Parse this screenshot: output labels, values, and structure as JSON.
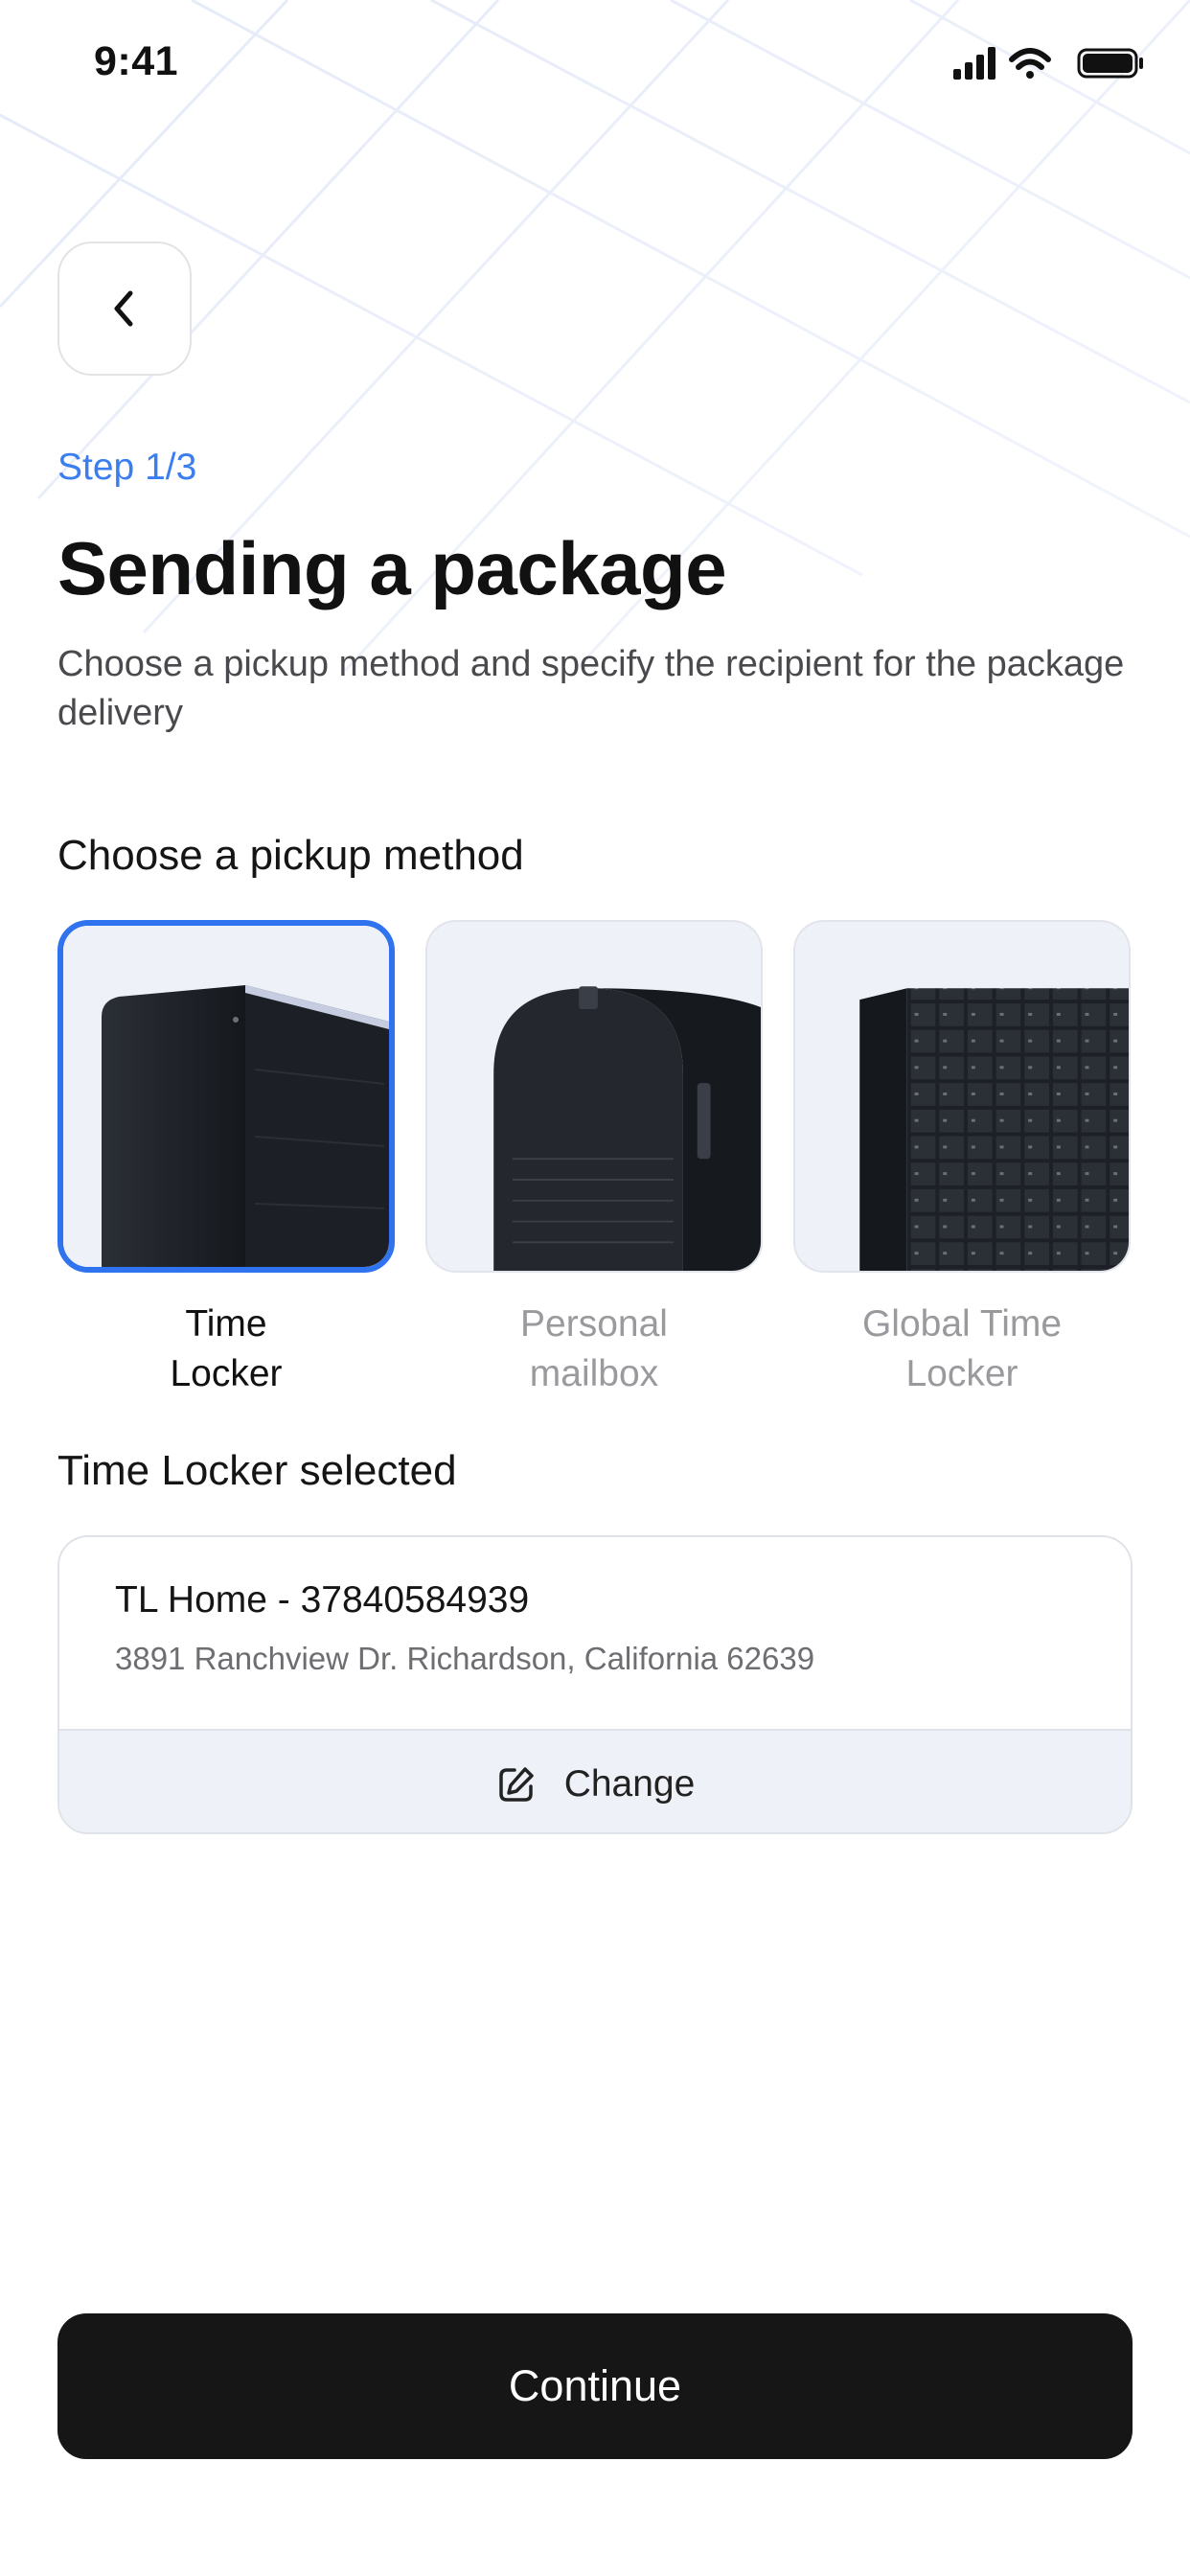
{
  "status_bar": {
    "time": "9:41",
    "icons": [
      "cellular-signal-icon",
      "wifi-icon",
      "battery-icon"
    ]
  },
  "back_icon": "chevron-left-icon",
  "header": {
    "step": "Step 1/3",
    "title": "Sending a package",
    "subtitle": "Choose a pickup method and specify the recipient for the package delivery"
  },
  "pickup": {
    "heading": "Choose a pickup method",
    "options": [
      {
        "label_line1": "Time",
        "label_line2": "Locker",
        "selected": true
      },
      {
        "label_line1": "Personal",
        "label_line2": "mailbox",
        "selected": false
      },
      {
        "label_line1": "Global Time",
        "label_line2": "Locker",
        "selected": false
      }
    ]
  },
  "selection": {
    "heading": "Time Locker selected",
    "name": "TL Home - 37840584939",
    "address": "3891 Ranchview Dr. Richardson, California 62639",
    "change_label": "Change",
    "change_icon": "edit-icon"
  },
  "continue_label": "Continue",
  "colors": {
    "accent": "#2f73ee",
    "step_text": "#3b7ef0",
    "primary_button": "#161616",
    "card_background": "#eef1f7"
  }
}
